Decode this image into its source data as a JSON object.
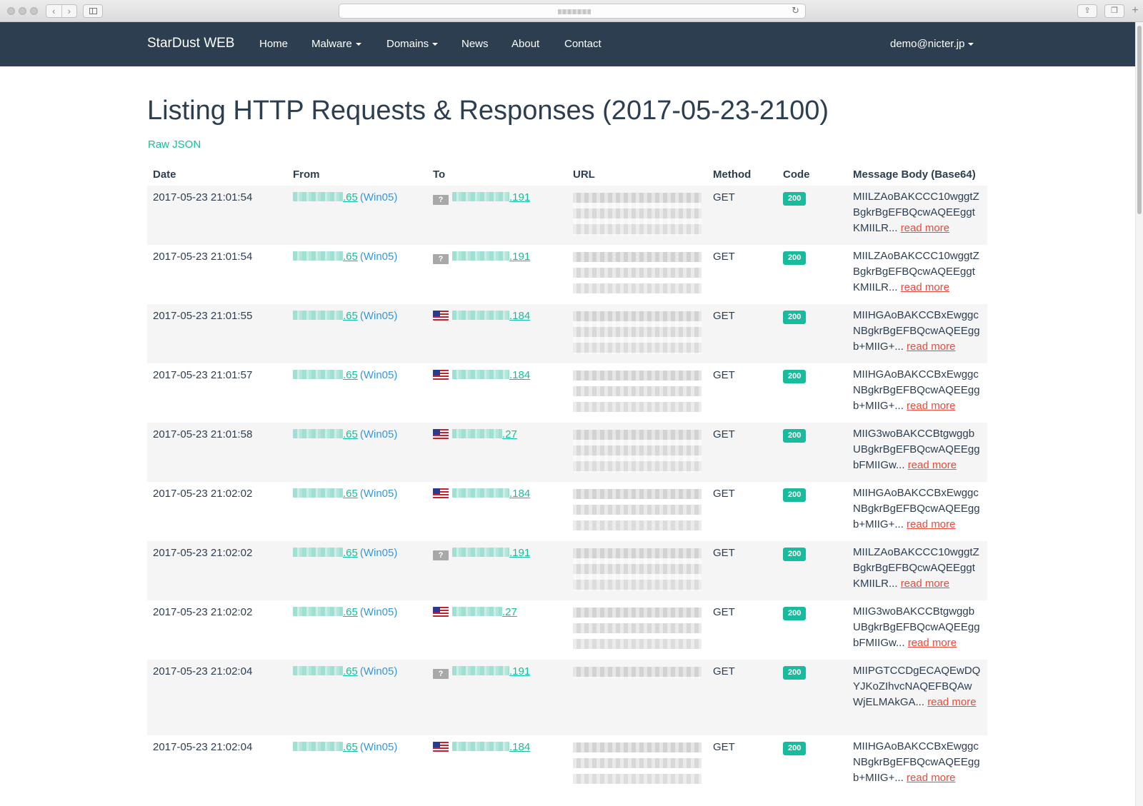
{
  "browser": {
    "url_hidden": true
  },
  "navbar": {
    "brand": "StarDust WEB",
    "items": [
      {
        "label": "Home",
        "dropdown": false
      },
      {
        "label": "Malware",
        "dropdown": true
      },
      {
        "label": "Domains",
        "dropdown": true
      },
      {
        "label": "News",
        "dropdown": false
      },
      {
        "label": "About",
        "dropdown": false
      },
      {
        "label": "Contact",
        "dropdown": false
      }
    ],
    "user": "demo@nicter.jp"
  },
  "page": {
    "title": "Listing HTTP Requests & Responses (2017-05-23-2100)",
    "raw_json_link": "Raw JSON"
  },
  "table": {
    "headers": [
      "Date",
      "From",
      "To",
      "URL",
      "Method",
      "Code",
      "Message Body (Base64)"
    ],
    "read_more_label": "read more",
    "rows": [
      {
        "date": "2017-05-23 21:01:54",
        "from_suffix": ".65",
        "from_host": "(Win05)",
        "to_flag": "unknown",
        "to_suffix": ".191",
        "method": "GET",
        "code": "200",
        "body": "MIILZAoBAKCCC10wggtZBgkrBgEFBQcwAQEEggtKMIILR..."
      },
      {
        "date": "2017-05-23 21:01:54",
        "from_suffix": ".65",
        "from_host": "(Win05)",
        "to_flag": "unknown",
        "to_suffix": ".191",
        "method": "GET",
        "code": "200",
        "body": "MIILZAoBAKCCC10wggtZBgkrBgEFBQcwAQEEggtKMIILR..."
      },
      {
        "date": "2017-05-23 21:01:55",
        "from_suffix": ".65",
        "from_host": "(Win05)",
        "to_flag": "us",
        "to_suffix": ".184",
        "method": "GET",
        "code": "200",
        "body": "MIIHGAoBAKCCBxEwggcNBgkrBgEFBQcwAQEEggb+MIIG+..."
      },
      {
        "date": "2017-05-23 21:01:57",
        "from_suffix": ".65",
        "from_host": "(Win05)",
        "to_flag": "us",
        "to_suffix": ".184",
        "method": "GET",
        "code": "200",
        "body": "MIIHGAoBAKCCBxEwggcNBgkrBgEFBQcwAQEEggb+MIIG+..."
      },
      {
        "date": "2017-05-23 21:01:58",
        "from_suffix": ".65",
        "from_host": "(Win05)",
        "to_flag": "us",
        "to_suffix": ".27",
        "method": "GET",
        "code": "200",
        "body": "MIIG3woBAKCCBtgwggbUBgkrBgEFBQcwAQEEggbFMIIGw..."
      },
      {
        "date": "2017-05-23 21:02:02",
        "from_suffix": ".65",
        "from_host": "(Win05)",
        "to_flag": "us",
        "to_suffix": ".184",
        "method": "GET",
        "code": "200",
        "body": "MIIHGAoBAKCCBxEwggcNBgkrBgEFBQcwAQEEggb+MIIG+..."
      },
      {
        "date": "2017-05-23 21:02:02",
        "from_suffix": ".65",
        "from_host": "(Win05)",
        "to_flag": "unknown",
        "to_suffix": ".191",
        "method": "GET",
        "code": "200",
        "body": "MIILZAoBAKCCC10wggtZBgkrBgEFBQcwAQEEggtKMIILR..."
      },
      {
        "date": "2017-05-23 21:02:02",
        "from_suffix": ".65",
        "from_host": "(Win05)",
        "to_flag": "us",
        "to_suffix": ".27",
        "method": "GET",
        "code": "200",
        "body": "MIIG3woBAKCCBtgwggbUBgkrBgEFBQcwAQEEggbFMIIGw..."
      },
      {
        "date": "2017-05-23 21:02:04",
        "from_suffix": ".65",
        "from_host": "(Win05)",
        "to_flag": "unknown",
        "to_suffix": ".191",
        "method": "GET",
        "code": "200",
        "body": "MIIPGTCCDgECAQEwDQYJKoZIhvcNAQEFBQAwWjELMAkGA..."
      },
      {
        "date": "2017-05-23 21:02:04",
        "from_suffix": ".65",
        "from_host": "(Win05)",
        "to_flag": "us",
        "to_suffix": ".184",
        "method": "GET",
        "code": "200",
        "body": "MIIHGAoBAKCCBxEwggcNBgkrBgEFBQcwAQEEggb+MIIG+..."
      }
    ]
  },
  "colors": {
    "navbar": "#2c3e50",
    "accent": "#18bc9c",
    "host_link": "#3498db",
    "read_more": "#e74c3c",
    "stripe": "#f5f5f5"
  },
  "icons": {
    "unknown_flag": "?",
    "reload": "↻",
    "back": "‹",
    "forward": "›"
  }
}
